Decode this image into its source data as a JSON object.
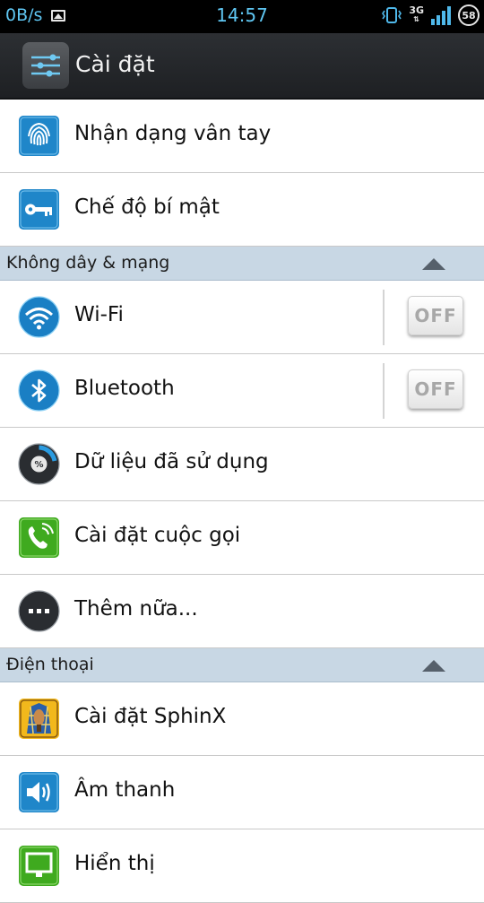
{
  "status_bar": {
    "net_speed": "0B/s",
    "time": "14:57",
    "network_type": "3G",
    "battery_level": "58",
    "icons": [
      "image-icon",
      "vibrate-icon",
      "network-3g-icon",
      "signal-icon",
      "battery-icon"
    ]
  },
  "action_bar": {
    "title": "Cài đặt",
    "icon": "settings-sliders-icon"
  },
  "colors": {
    "status_text": "#5fc6f2",
    "section_header_bg": "#c8d7e4",
    "action_bar_bg": "#2c2f33"
  },
  "items_top": [
    {
      "label": "Nhận dạng vân tay",
      "icon": "fingerprint-icon"
    },
    {
      "label": "Chế độ bí mật",
      "icon": "key-icon"
    }
  ],
  "sections": [
    {
      "title": "Không dây & mạng",
      "items": [
        {
          "label": "Wi-Fi",
          "icon": "wifi-icon",
          "toggle": "OFF"
        },
        {
          "label": "Bluetooth",
          "icon": "bluetooth-icon",
          "toggle": "OFF"
        },
        {
          "label": "Dữ liệu đã sử dụng",
          "icon": "data-usage-icon"
        },
        {
          "label": "Cài đặt cuộc gọi",
          "icon": "phone-icon"
        },
        {
          "label": "Thêm nữa...",
          "icon": "more-icon"
        }
      ]
    },
    {
      "title": "Điện thoại",
      "items": [
        {
          "label": "Cài đặt SphinX",
          "icon": "sphinx-icon"
        },
        {
          "label": "Âm thanh",
          "icon": "speaker-icon"
        },
        {
          "label": "Hiển thị",
          "icon": "display-icon"
        }
      ]
    }
  ]
}
